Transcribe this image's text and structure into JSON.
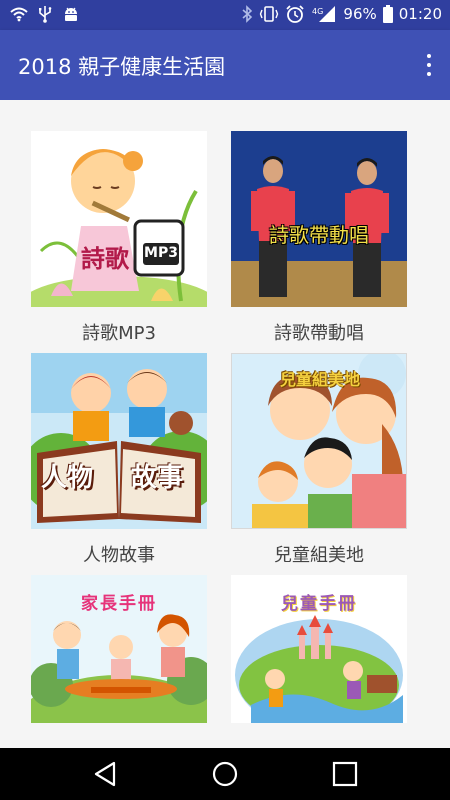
{
  "statusbar": {
    "battery": "96%",
    "time": "01:20",
    "icons": [
      "wifi-icon",
      "usb-icon",
      "android-icon",
      "bluetooth-icon",
      "vibrate-icon",
      "alarm-icon",
      "signal-4g-icon",
      "battery-icon"
    ]
  },
  "appbar": {
    "title": "2018 親子健康生活園",
    "menu_icon": "overflow-menu-icon"
  },
  "grid": {
    "items": [
      {
        "label": "詩歌MP3",
        "overlay": "詩歌",
        "badge": "MP3"
      },
      {
        "label": "詩歌帶動唱",
        "overlay": "詩歌帶動唱"
      },
      {
        "label": "人物故事",
        "overlay_left": "人物",
        "overlay_right": "故事"
      },
      {
        "label": "兒童組美地",
        "overlay": "兒童組美地"
      },
      {
        "label": "",
        "overlay": "家長手冊"
      },
      {
        "label": "",
        "overlay": "兒童手冊"
      }
    ]
  },
  "navbar": {
    "icons": [
      "back-icon",
      "home-icon",
      "recents-icon"
    ]
  }
}
